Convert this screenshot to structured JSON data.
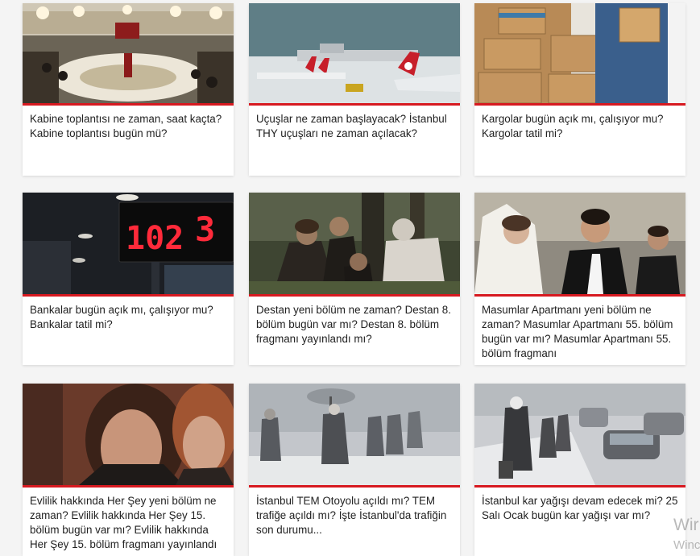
{
  "cards": [
    {
      "title": "Kabine toplantısı ne zaman, saat kaçta? Kabine toplantısı bugün mü?",
      "image": "cabinet-meeting-photo"
    },
    {
      "title": "Uçuşlar ne zaman başlayacak? İstanbul THY uçuşları ne zaman açılacak?",
      "image": "snowy-airport-planes-photo"
    },
    {
      "title": "Kargolar bugün açık mı, çalışıyor mu? Kargolar tatil mi?",
      "image": "cargo-boxes-photo"
    },
    {
      "title": "Bankalar bugün açık mı, çalışıyor mu? Bankalar tatil mi?",
      "image": "bank-queue-display-photo",
      "display_number": "102",
      "display_counter": "3"
    },
    {
      "title": "Destan yeni bölüm ne zaman? Destan 8. bölüm bugün var mı? Destan 8. bölüm fragmanı yayınlandı mı?",
      "image": "destan-series-still"
    },
    {
      "title": "Masumlar Apartmanı yeni bölüm ne zaman? Masumlar Apartmanı 55. bölüm bugün var mı? Masumlar Apartmanı 55. bölüm fragmanı",
      "image": "wedding-couple-still"
    },
    {
      "title": "Evlilik hakkında Her Şey yeni bölüm ne zaman? Evlilik hakkında Her Şey 15. bölüm bugün var mı? Evlilik hakkında Her Şey 15. bölüm fragmanı yayınlandı",
      "image": "two-women-still"
    },
    {
      "title": "İstanbul TEM Otoyolu açıldı mı? TEM trafiğe açıldı mı? İşte İstanbul'da trafiğin son durumu...",
      "image": "snowstorm-pedestrians-photo"
    },
    {
      "title": "İstanbul kar yağışı devam edecek mi? 25 Salı Ocak bugün kar yağışı var mı?",
      "image": "snowy-traffic-photo"
    }
  ],
  "watermark": {
    "line1": "Wir",
    "line2": "Winc"
  },
  "colors": {
    "accent": "#d71920",
    "card_bg": "#ffffff",
    "page_bg": "#f4f4f4",
    "text": "#222222"
  }
}
